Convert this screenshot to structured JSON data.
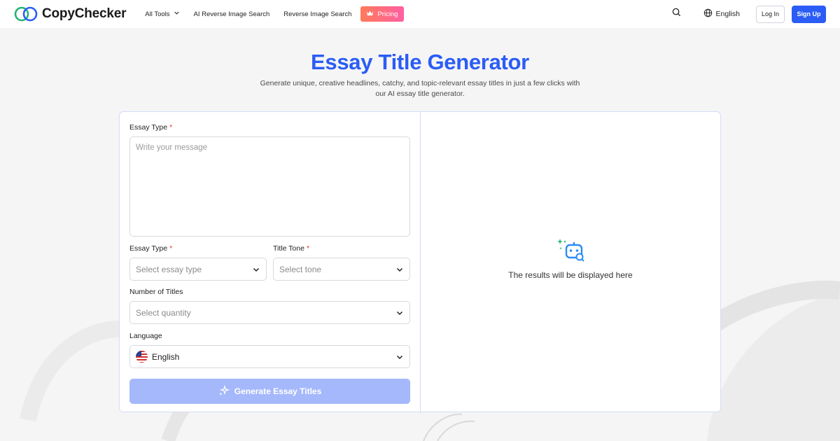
{
  "header": {
    "brand": "CopyChecker",
    "nav": [
      {
        "label": "All Tools",
        "has_dropdown": true
      },
      {
        "label": "AI Reverse Image Search"
      },
      {
        "label": "Reverse Image Search"
      }
    ],
    "pricing_label": "Pricing",
    "language": "English",
    "login_label": "Log In",
    "signup_label": "Sign Up"
  },
  "hero": {
    "title": "Essay Title Generator",
    "subtitle_line1": "Generate unique, creative headlines, catchy, and topic-relevant essay titles in just a few clicks with",
    "subtitle_line2": "our AI essay title generator."
  },
  "form": {
    "topic_label": "Essay Type",
    "topic_placeholder": "Write your message",
    "essay_type_label": "Essay Type",
    "essay_type_placeholder": "Select essay type",
    "tone_label": "Title Tone",
    "tone_placeholder": "Select tone",
    "count_label": "Number of Titles",
    "count_placeholder": "Select quantity",
    "language_label": "Language",
    "language_value": "English",
    "required_mark": "*",
    "generate_label": "Generate Essay Titles"
  },
  "result": {
    "empty_text": "The results will be displayed here"
  },
  "colors": {
    "accent": "#2b5cf5",
    "disabled_button": "#a5b8fb",
    "required": "#e53935"
  }
}
